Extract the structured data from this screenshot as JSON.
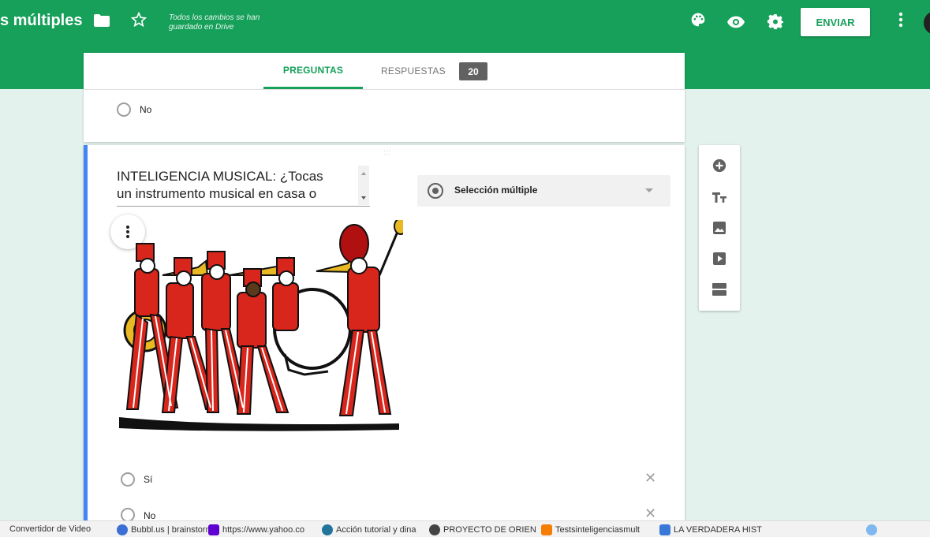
{
  "header": {
    "title": "s múltiples",
    "saved_line1": "Todos los cambios se han",
    "saved_line2": "guardado en Drive",
    "send_label": "ENVIAR",
    "icons": [
      "folder-icon",
      "star-icon",
      "palette-icon",
      "eye-icon",
      "gear-icon",
      "more-vert-icon"
    ]
  },
  "tabs": {
    "questions": "PREGUNTAS",
    "responses": "RESPUESTAS",
    "responses_count": "20"
  },
  "prev_question": {
    "option_label": "No"
  },
  "question": {
    "title_line1": "INTELIGENCIA MUSICAL: ¿Tocas",
    "title_line2": "un instrumento musical en casa o",
    "type": "Selección múltiple",
    "options": [
      "Sí",
      "No"
    ]
  },
  "side_toolbar": [
    "add-question-icon",
    "title-icon",
    "image-icon",
    "video-icon",
    "section-icon"
  ],
  "bookmarks": [
    "Convertidor de Video",
    "Bubbl.us | brainstorm",
    "https://www.yahoo.co",
    "Acción tutorial y dina",
    "PROYECTO DE ORIEN",
    "Testsinteligenciasmult",
    "LA VERDADERA HIST"
  ],
  "colors": {
    "brand": "#16a05a",
    "accent_border": "#4285f4",
    "page_bg": "#e3f2ec"
  }
}
